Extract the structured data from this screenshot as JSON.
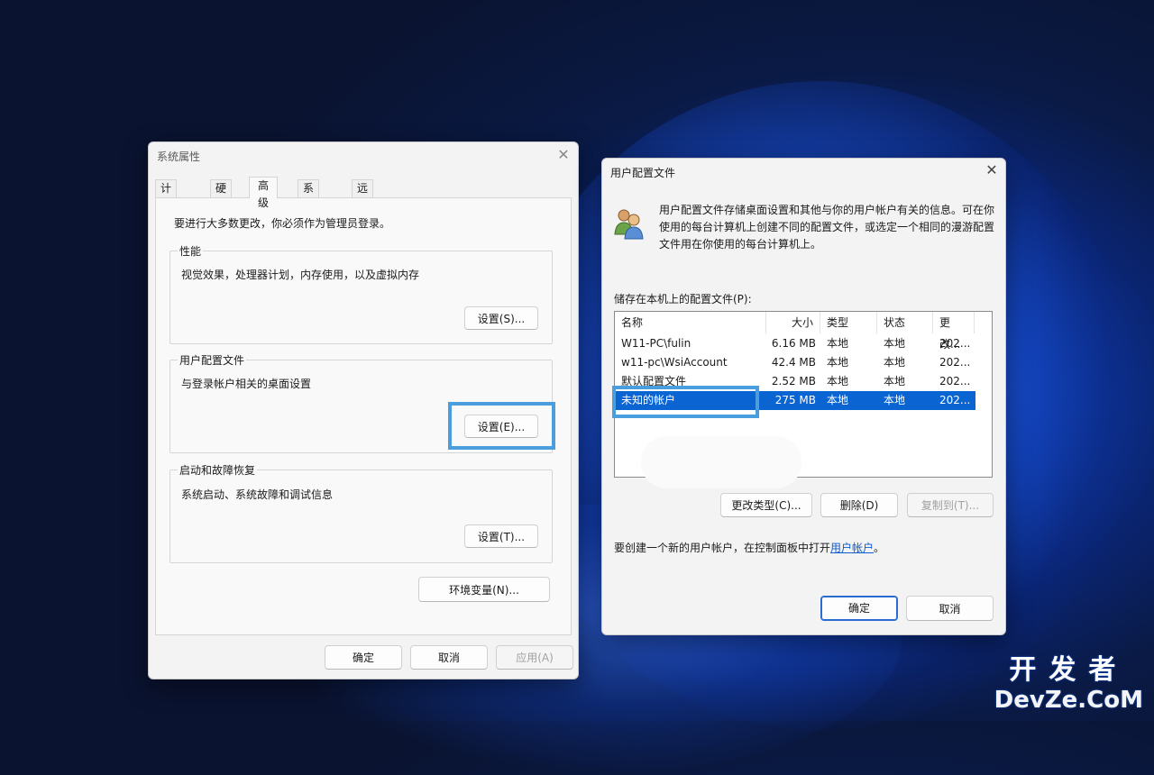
{
  "sysprops": {
    "title": "系统属性",
    "close_glyph": "✕",
    "tabs": [
      "计算机名",
      "硬件",
      "高级",
      "系统保护",
      "远程"
    ],
    "active_tab": "高级",
    "admin_note": "要进行大多数更改，你必须作为管理员登录。",
    "performance": {
      "label": "性能",
      "desc": "视觉效果，处理器计划，内存使用，以及虚拟内存",
      "button": "设置(S)..."
    },
    "profiles": {
      "label": "用户配置文件",
      "desc": "与登录帐户相关的桌面设置",
      "button": "设置(E)..."
    },
    "startup": {
      "label": "启动和故障恢复",
      "desc": "系统启动、系统故障和调试信息",
      "button": "设置(T)..."
    },
    "env_button": "环境变量(N)...",
    "ok": "确定",
    "cancel": "取消",
    "apply": "应用(A)"
  },
  "profiles_dialog": {
    "title": "用户配置文件",
    "close_glyph": "✕",
    "icon": "users-icon",
    "intro": "用户配置文件存储桌面设置和其他与你的用户帐户有关的信息。可在你使用的每台计算机上创建不同的配置文件，或选定一个相同的漫游配置文件用在你使用的每台计算机上。",
    "list_label": "储存在本机上的配置文件(P):",
    "columns": [
      "名称",
      "大小",
      "类型",
      "状态",
      "更改..."
    ],
    "rows": [
      {
        "name": "W11-PC\\fulin",
        "size": "6.16 MB",
        "type": "本地",
        "status": "本地",
        "modified": "202..."
      },
      {
        "name": "w11-pc\\WsiAccount",
        "size": "42.4 MB",
        "type": "本地",
        "status": "本地",
        "modified": "202..."
      },
      {
        "name": "默认配置文件",
        "size": "2.52 MB",
        "type": "本地",
        "status": "本地",
        "modified": "202..."
      },
      {
        "name": "未知的帐户",
        "size": "275 MB",
        "type": "本地",
        "status": "本地",
        "modified": "202..."
      }
    ],
    "selected_row": 3,
    "change_type_button": "更改类型(C)...",
    "delete_button": "删除(D)",
    "copy_to_button": "复制到(T)...",
    "create_note": "要创建一个新的用户帐户，在控制面板中打开",
    "create_link": "用户帐户",
    "create_note_end": "。",
    "ok": "确定",
    "cancel": "取消"
  },
  "watermark": {
    "line1": "开发者",
    "line2": "DevZe.CoM"
  },
  "colors": {
    "accent": "#0a64d2",
    "highlight": "#4a9ede"
  }
}
